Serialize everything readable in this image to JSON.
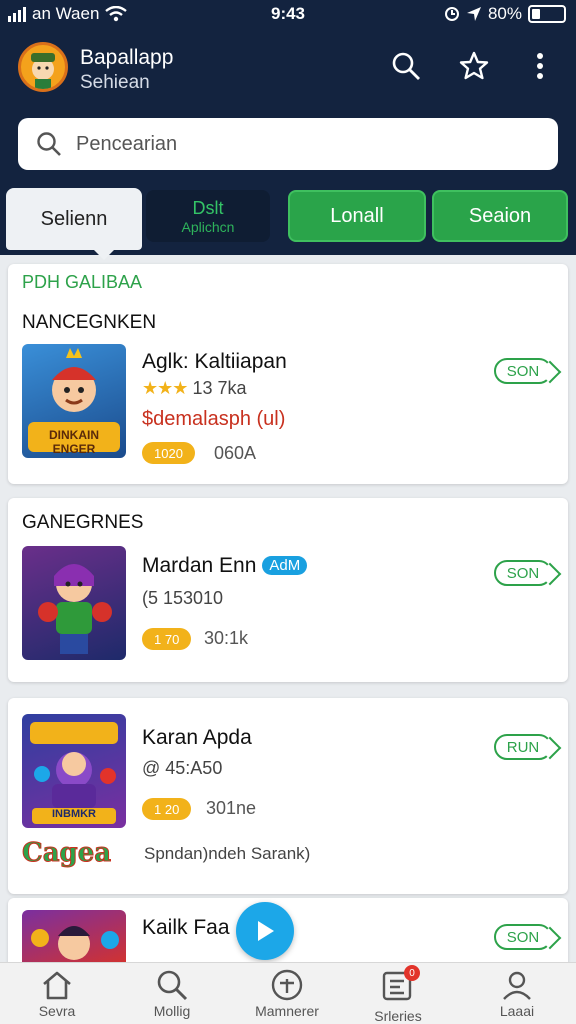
{
  "status": {
    "carrier": "an Waen",
    "time": "9:43",
    "battery": "80%"
  },
  "header": {
    "app_name": "Bapallapp",
    "subtitle": "Sehiean"
  },
  "search": {
    "placeholder": "Pencearian"
  },
  "tabs": [
    {
      "label": "Selienn"
    },
    {
      "label": "Dslt",
      "sublabel": "Aplichcn"
    },
    {
      "label": "Lonall"
    },
    {
      "label": "Seaion"
    }
  ],
  "cards": [
    {
      "tag": "PDH GALIBAA",
      "section": "NANCEGNKEN",
      "thumb_text": "DINKAIN ENGER",
      "title": "Aglk: Kaltiiapan",
      "stars": "★★★",
      "rating": "13 7ka",
      "price": "$demalasph (ul)",
      "pill": "1020",
      "count": "060A",
      "button": "SON"
    },
    {
      "section": "GANEGRNES",
      "title": "Mardan Enn",
      "ad": "AdM",
      "rating": "(5 153010",
      "pill": "1 70",
      "count": "30:1k",
      "button": "SON"
    },
    {
      "thumb_text": "INBMKR",
      "title": "Karan Apda",
      "rating": "@ 45:A50",
      "pill": "1 20",
      "count": "301ne",
      "footer": "Spndan)ndeh Sarank)",
      "logo_text": "Cagea",
      "button": "RUN"
    },
    {
      "title": "Kailk Faa",
      "button": "SON"
    }
  ],
  "nav": [
    {
      "label": "Sevra"
    },
    {
      "label": "Mollig"
    },
    {
      "label": "Mamnerer"
    },
    {
      "label": "Srleries",
      "badge": "0"
    },
    {
      "label": "Laaai"
    }
  ]
}
